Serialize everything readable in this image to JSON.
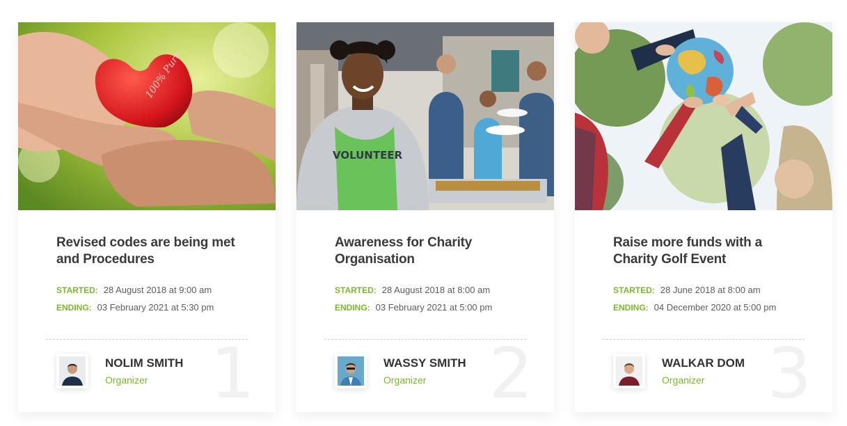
{
  "colors": {
    "accent": "#7bb72e",
    "title": "#3a3a3a",
    "muted_number": "#f1f1f1"
  },
  "cards": [
    {
      "image_icon": "heart-in-hands-photo",
      "title": "Revised codes are being met and Procedures",
      "started_label": "STARTED:",
      "started_value": "28 August 2018 at 9:00 am",
      "ending_label": "ENDING:",
      "ending_value": "03 February 2021 at 5:30 pm",
      "organizer_name": "NOLIM SMITH",
      "organizer_role": "Organizer",
      "number": "1"
    },
    {
      "image_icon": "volunteer-food-service-photo",
      "title": "Awareness for Charity Organisation",
      "started_label": "STARTED:",
      "started_value": "28 August 2018 at 8:00 am",
      "ending_label": "ENDING:",
      "ending_value": "03 February 2021 at 5:00 pm",
      "organizer_name": "WASSY SMITH",
      "organizer_role": "Organizer",
      "number": "2"
    },
    {
      "image_icon": "hands-holding-globe-photo",
      "title": "Raise more funds with a Charity Golf Event",
      "started_label": "STARTED:",
      "started_value": "28 June 2018 at 8:00 am",
      "ending_label": "ENDING:",
      "ending_value": "04 December 2020 at 5:00 pm",
      "organizer_name": "WALKAR DOM",
      "organizer_role": "Organizer",
      "number": "3"
    }
  ]
}
